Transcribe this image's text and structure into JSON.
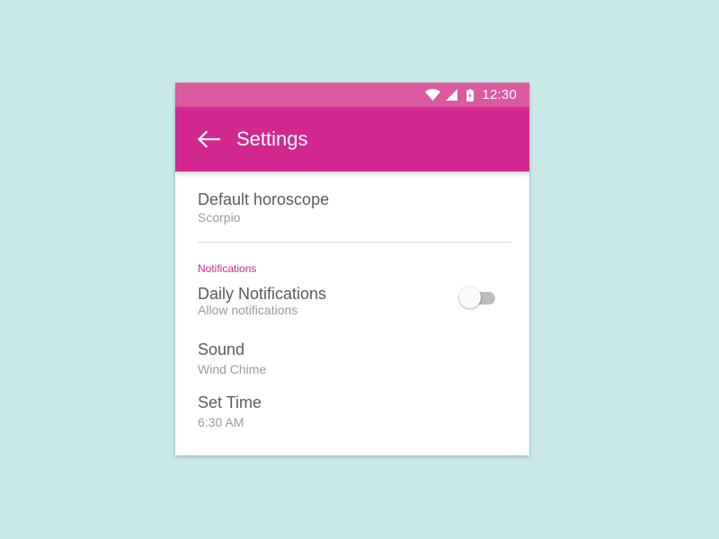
{
  "status_bar": {
    "time": "12:30",
    "icons": [
      "wifi-icon",
      "signal-icon",
      "battery-charging-icon"
    ]
  },
  "app_bar": {
    "title": "Settings",
    "back_icon": "arrow-left-icon"
  },
  "preferences": {
    "default_horoscope": {
      "title": "Default horoscope",
      "summary": "Scorpio"
    },
    "notifications_header": "Notifications",
    "daily_notifications": {
      "title": "Daily Notifications",
      "summary": "Allow notifications",
      "enabled": false
    },
    "sound": {
      "title": "Sound",
      "summary": "Wind Chime"
    },
    "set_time": {
      "title": "Set Time",
      "summary": "6:30 AM"
    }
  },
  "colors": {
    "background": "#c9e8e7",
    "status_bar": "#dc5aa0",
    "app_bar": "#d42891",
    "accent": "#d42891"
  }
}
